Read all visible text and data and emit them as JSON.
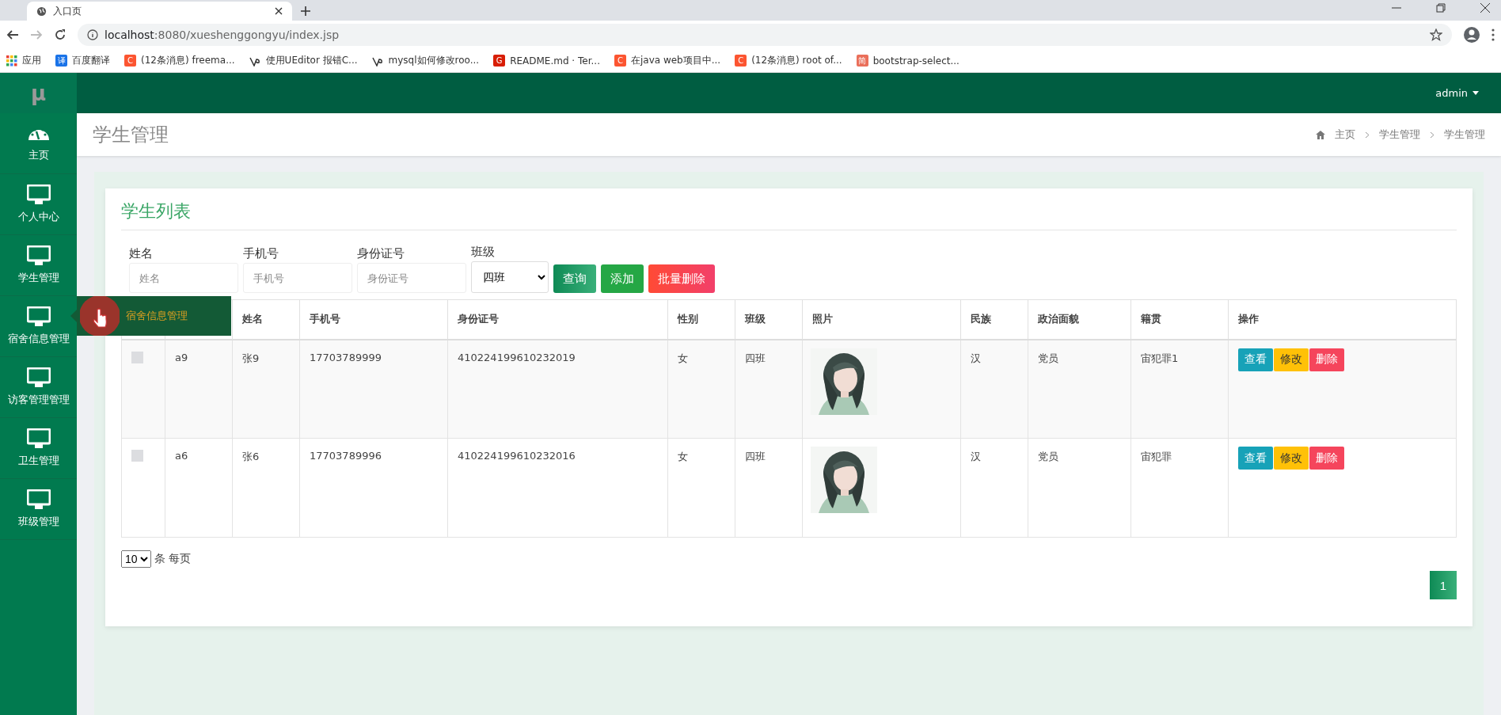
{
  "browser": {
    "tab_title": "入口页",
    "url_host": "localhost",
    "url_rest": ":8080/xueshenggongyu/index.jsp",
    "bookmarks": [
      {
        "kind": "apps",
        "label": "应用"
      },
      {
        "kind": "letter",
        "badge": "译",
        "color": "#1a73e8",
        "label": "百度翻译"
      },
      {
        "kind": "letter",
        "badge": "C",
        "color": "#fc5531",
        "label": "(12条消息) freema..."
      },
      {
        "kind": "swirl",
        "label": "使用UEditor 报错C..."
      },
      {
        "kind": "swirl",
        "label": "mysql如何修改roo..."
      },
      {
        "kind": "letter",
        "badge": "G",
        "color": "#d81e06",
        "label": "README.md · Ter..."
      },
      {
        "kind": "letter",
        "badge": "C",
        "color": "#fc5531",
        "label": "在java web项目中..."
      },
      {
        "kind": "letter",
        "badge": "C",
        "color": "#fc5531",
        "label": "(12条消息) root of..."
      },
      {
        "kind": "letter",
        "badge": "简",
        "color": "#ea6f5a",
        "label": "bootstrap-select..."
      }
    ]
  },
  "app": {
    "logo": "μ",
    "user_menu": "admin"
  },
  "sidebar": {
    "items": [
      {
        "kind": "dashboard",
        "label": "主页"
      },
      {
        "kind": "monitor",
        "label": "个人中心"
      },
      {
        "kind": "monitor",
        "label": "学生管理"
      },
      {
        "kind": "monitor",
        "label": "宿舍信息管理"
      },
      {
        "kind": "monitor",
        "label": "访客管理管理"
      },
      {
        "kind": "monitor",
        "label": "卫生管理"
      },
      {
        "kind": "monitor",
        "label": "班级管理"
      }
    ],
    "tooltip": "宿舍信息管理"
  },
  "header": {
    "title": "学生管理",
    "breadcrumb": [
      "主页",
      "学生管理",
      "学生管理"
    ]
  },
  "card": {
    "title": "学生列表",
    "filters": [
      {
        "kind": "input",
        "label": "姓名",
        "placeholder": "姓名"
      },
      {
        "kind": "input",
        "label": "手机号",
        "placeholder": "手机号"
      },
      {
        "kind": "input",
        "label": "身份证号",
        "placeholder": "身份证号"
      },
      {
        "kind": "select",
        "label": "班级",
        "value": "四班"
      }
    ],
    "buttons": [
      {
        "kind": "search",
        "label": "查询"
      },
      {
        "kind": "add",
        "label": "添加"
      },
      {
        "kind": "delete",
        "label": "批量删除"
      }
    ],
    "table": {
      "columns": [
        "姓名",
        "手机号",
        "身份证号",
        "性别",
        "班级",
        "照片",
        "民族",
        "政治面貌",
        "籍贯",
        "操作"
      ],
      "rows": [
        {
          "checked": false,
          "account": "a9",
          "name": "张9",
          "phone": "17703789999",
          "id_number": "410224199610232019",
          "gender": "女",
          "class": "四班",
          "photo": {
            "kind": "picture"
          },
          "ethnicity": "汉",
          "political_status": "党员",
          "native_place": "宙犯罪1",
          "actions": [
            "查看",
            "修改",
            "删除"
          ]
        },
        {
          "checked": false,
          "account": "a6",
          "name": "张6",
          "phone": "17703789996",
          "id_number": "410224199610232016",
          "gender": "女",
          "class": "四班",
          "photo": {
            "kind": "picture"
          },
          "ethnicity": "汉",
          "political_status": "党员",
          "native_place": "宙犯罪",
          "actions": [
            "查看",
            "修改",
            "删除"
          ]
        }
      ]
    },
    "page_size": {
      "value": "10",
      "label": "条 每页"
    },
    "pages": [
      {
        "label": "1",
        "selected": true
      }
    ]
  }
}
